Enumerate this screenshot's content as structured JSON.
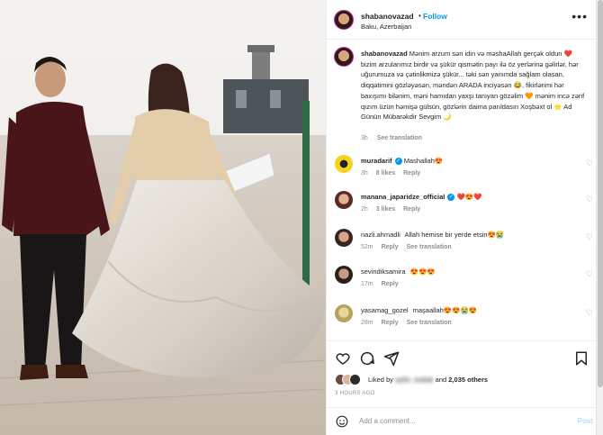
{
  "post": {
    "username": "shabanovazad",
    "follow_label": "Follow",
    "dot": "•",
    "location": "Baku, Azerbaijan",
    "more": "•••"
  },
  "caption": {
    "username": "shabanovazad",
    "text": "Mənim arzum sən idin və məshaAllah gerçək oldun ❤️ bizim arzularımız birdir və şükür qismətin payı ilə öz yerlərinə gəlirlər, hər uğurumuza və çətinlikmizə şükür... təki sən yanımda sağlam olasan, diqqətimini gözləyəsən, məndən ARADA inciyəsən 😂, fikirlərimi hər baxışımı bilənim, məni hamıdan yaxşı tanıyan gözəlim 🧡 mənim incə zərif qızım üzün həmişə gülsün, gözlərin daima parıldasın Xoşbəxt ol 🌟 Ad Günün Mübarəkdir Sevgim 🌙",
    "time": "3h",
    "see_translation": "See translation"
  },
  "comments": [
    {
      "username": "muradarif",
      "verified": true,
      "text": "Mashallah😍",
      "time": "3h",
      "likes": "8 likes",
      "reply": "Reply",
      "translation": ""
    },
    {
      "username": "manana_japaridze_official",
      "verified": true,
      "text": "❤️😍❤️",
      "time": "2h",
      "likes": "3 likes",
      "reply": "Reply",
      "translation": ""
    },
    {
      "username": "nazli.ahmadli",
      "verified": false,
      "text": "Allah hemise bir yerde etsin😍😭",
      "time": "52m",
      "likes": "",
      "reply": "Reply",
      "translation": "See translation"
    },
    {
      "username": "sevindiksamira",
      "verified": false,
      "text": "😍😍😍",
      "time": "17m",
      "likes": "",
      "reply": "Reply",
      "translation": ""
    },
    {
      "username": "yasamag_gozel",
      "verified": false,
      "text": "maşaallah😍😍😭😍",
      "time": "28m",
      "likes": "",
      "reply": "Reply",
      "translation": "See translation"
    }
  ],
  "likes": {
    "prefix": "Liked by",
    "name": "aylin_malak",
    "and": "and",
    "others": "2,035 others"
  },
  "time_ago": "3 HOURS AGO",
  "add_comment": {
    "placeholder": "Add a comment...",
    "post_label": "Post"
  },
  "icons": {
    "like": "heart-icon",
    "comment": "comment-icon",
    "share": "share-icon",
    "save": "bookmark-icon",
    "emoji": "emoji-icon",
    "more": "more-icon"
  },
  "colors": {
    "accent": "#0095f6",
    "muted": "#8e8e8e",
    "text": "#262626",
    "post_disabled": "#b2dffc"
  }
}
